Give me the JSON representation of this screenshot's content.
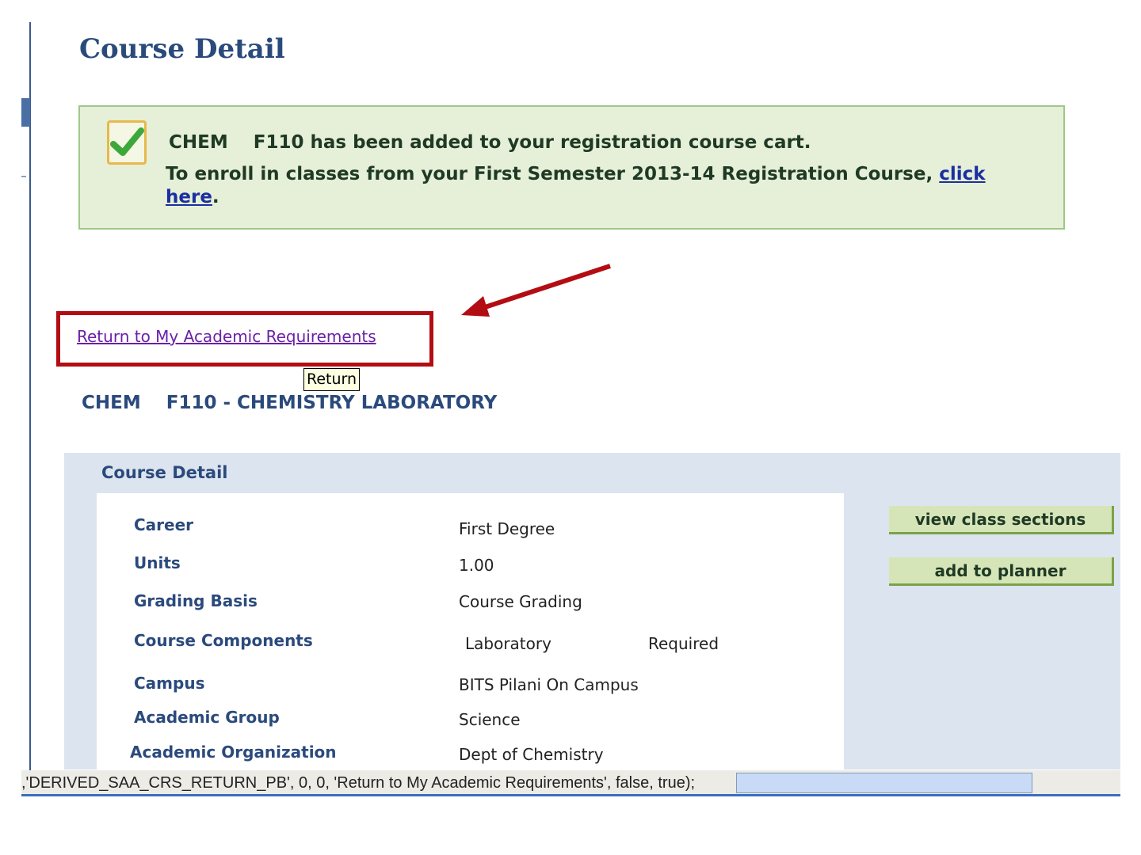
{
  "page": {
    "title": "Course Detail"
  },
  "message": {
    "line1": "CHEM    F110 has been added to your registration course cart.",
    "line2_prefix": "To enroll in classes from your First Semester 2013-14 Registration Course, ",
    "link_text": "click here",
    "line2_suffix": ".",
    "icon": "checkmark-icon"
  },
  "return_link": {
    "label": "Return to My Academic Requirements",
    "tooltip": "Return"
  },
  "course": {
    "heading": "CHEM    F110 - CHEMISTRY LABORATORY"
  },
  "detail_panel": {
    "title": "Course Detail",
    "fields": [
      {
        "label": "Career",
        "value": "First Degree"
      },
      {
        "label": "Units",
        "value": "1.00"
      },
      {
        "label": "Grading Basis",
        "value": "Course Grading"
      },
      {
        "label": "Course Components",
        "value": "Laboratory",
        "value2": "Required"
      },
      {
        "label": "Campus",
        "value": "BITS Pilani On Campus"
      },
      {
        "label": "Academic Group",
        "value": "Science"
      },
      {
        "label": "Academic Organization",
        "value": "Dept of Chemistry"
      }
    ],
    "buttons": {
      "view_sections": "view class sections",
      "add_planner": "add to planner"
    }
  },
  "statusbar": {
    "text": ",'DERIVED_SAA_CRS_RETURN_PB', 0, 0, 'Return to My Academic Requirements', false, true);"
  },
  "colors": {
    "heading": "#2b4a7c",
    "message_bg": "#e6efd8",
    "highlight": "#b30d14"
  }
}
